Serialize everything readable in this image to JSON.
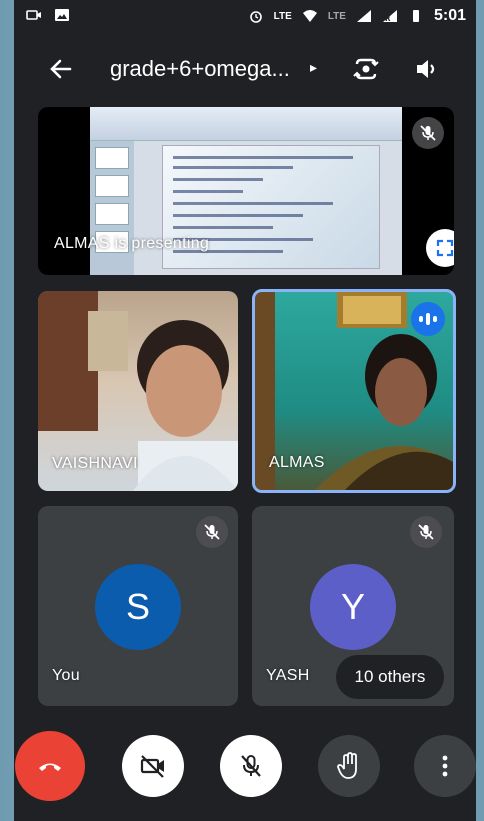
{
  "status_bar": {
    "left_icons": [
      "video-record-icon",
      "image-icon"
    ],
    "right_icons": [
      "alarm-icon",
      "volte-call-icon",
      "wifi-icon",
      "lte-icon",
      "signal-icon",
      "signal-roaming-icon",
      "battery-icon"
    ],
    "lte_label": "LTE",
    "lte2_label": "LTE",
    "time": "5:01"
  },
  "top_bar": {
    "meeting_title": "grade+6+omega...",
    "caret": "▸",
    "icons": [
      "back-arrow-icon",
      "switch-camera-icon",
      "speaker-icon"
    ]
  },
  "presentation": {
    "label": "ALMAS is presenting",
    "mic_muted": true,
    "fullscreen_icon": "fullscreen-icon"
  },
  "participants": [
    {
      "name": "VAISHNAVI",
      "video": true
    },
    {
      "name": "ALMAS",
      "video": true,
      "speaking": true
    },
    {
      "name": "You",
      "initial": "S",
      "avatar_color": "#0b5cad",
      "mic_muted": true
    },
    {
      "name": "YASH",
      "initial": "Y",
      "avatar_color": "#5b5fc7",
      "mic_muted": true
    }
  ],
  "others_label": "10 others",
  "controls": {
    "end_call_icon": "end-call-icon",
    "camera_icon": "camera-off-icon",
    "mic_icon": "mic-off-icon",
    "hand_icon": "raise-hand-icon",
    "more_icon": "more-vert-icon"
  },
  "colors": {
    "background": "#202124",
    "tile": "#3c4043",
    "end_call": "#ea4335",
    "active_speaker": "#8ab4f8",
    "speaking_badge": "#1a73e8"
  }
}
